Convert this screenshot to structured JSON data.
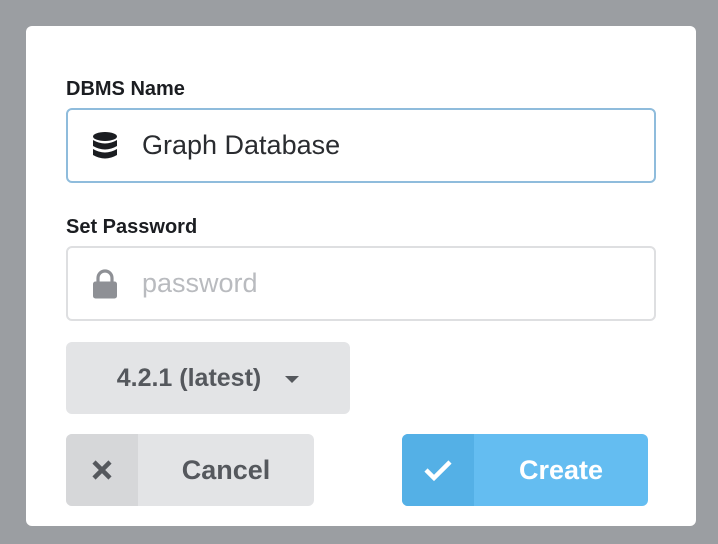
{
  "form": {
    "name_label": "DBMS Name",
    "name_value": "Graph Database",
    "password_label": "Set Password",
    "password_placeholder": "password",
    "password_value": ""
  },
  "version": {
    "selected": "4.2.1 (latest)"
  },
  "actions": {
    "cancel_label": "Cancel",
    "create_label": "Create"
  },
  "icons": {
    "name_field": "database-icon",
    "password_field": "lock-icon",
    "dropdown": "caret-down-icon",
    "cancel": "close-icon",
    "create": "check-icon"
  },
  "colors": {
    "overlay": "#9b9ea2",
    "focus_border": "#8fbcdc",
    "primary": "#64bdf1",
    "primary_dark": "#54b0e6",
    "secondary": "#e3e4e6"
  }
}
